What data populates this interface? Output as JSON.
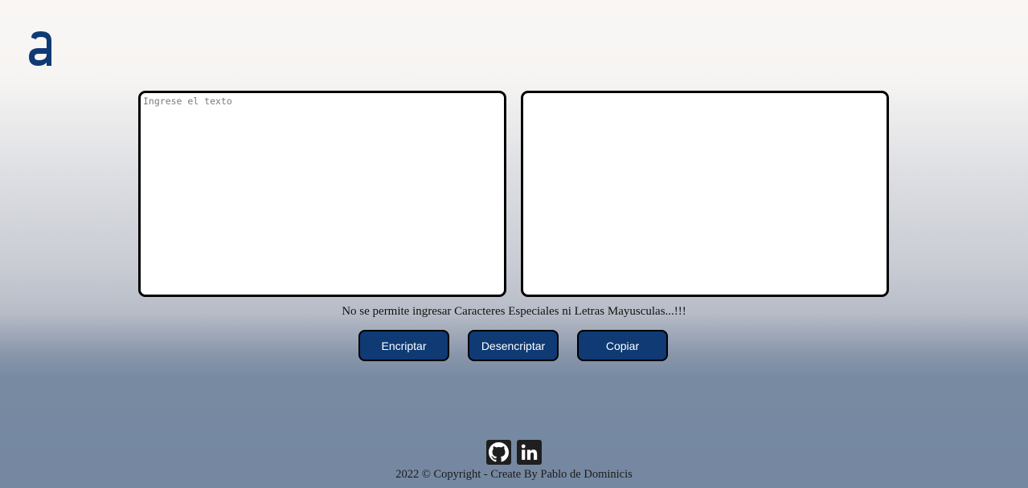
{
  "header": {
    "logo_icon": "alura-logo-icon",
    "brand_color": "#0f3a74"
  },
  "input": {
    "placeholder": "Ingrese el texto",
    "value": ""
  },
  "output": {
    "value": ""
  },
  "warning_text": "No se permite ingresar Caracteres Especiales ni Letras Mayusculas...!!!",
  "buttons": {
    "encrypt_label": "Encriptar",
    "decrypt_label": "Desencriptar",
    "copy_label": "Copiar"
  },
  "footer": {
    "github_icon": "github-icon",
    "linkedin_icon": "linkedin-icon",
    "copyright": "2022 © Copyright - Create By Pablo de Dominicis"
  }
}
